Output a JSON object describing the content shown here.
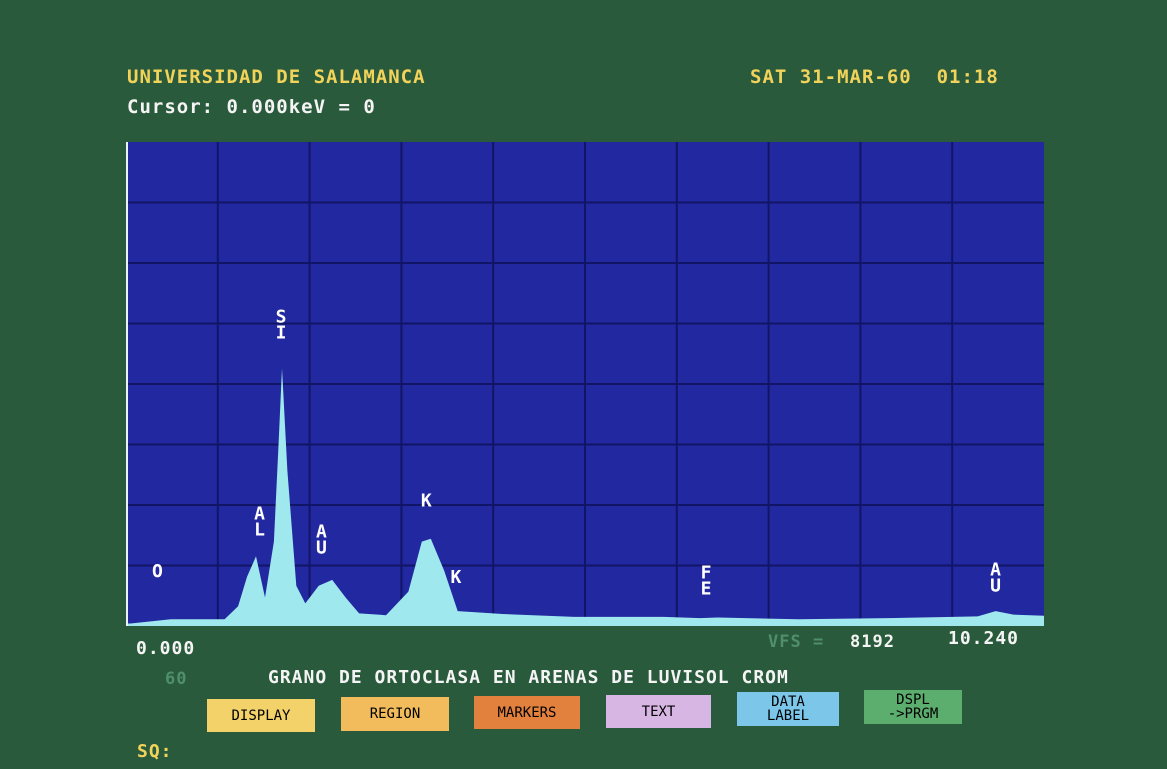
{
  "header": {
    "institution": "UNIVERSIDAD DE SALAMANCA",
    "datetime": "SAT 31-MAR-60  01:18",
    "cursor": "Cursor: 0.000keV = 0"
  },
  "axis": {
    "left_label": "0.000",
    "right_label": "10.240",
    "vfs_label": "VFS =",
    "vfs_value": "8192"
  },
  "aux_number": "60",
  "sample_title": "GRANO DE ORTOCLASA EN ARENAS DE LUVISOL CROM",
  "prompt": "SQ:",
  "menu": [
    {
      "label": "DISPLAY",
      "color": "#f3d26a"
    },
    {
      "label": "REGION",
      "color": "#f2bc5c"
    },
    {
      "label": "MARKERS",
      "color": "#e2803e"
    },
    {
      "label": "TEXT",
      "color": "#d7b6e4"
    },
    {
      "label1": "DATA",
      "label2": "LABEL",
      "color": "#7cc6ea"
    },
    {
      "label1": "DSPL",
      "label2": "->PRGM",
      "color": "#5cae6e"
    }
  ],
  "colors": {
    "plot_background": "#2228a0",
    "grid": "#111566",
    "spectrum": "#9fe8ee",
    "peak_label": "#ffffff"
  },
  "peak_labels": [
    "O",
    "AL",
    "SI",
    "AU",
    "K",
    "K",
    "FE",
    "AU"
  ],
  "chart_data": {
    "type": "area",
    "title": "",
    "xlabel": "",
    "ylabel": "",
    "xlim": [
      0.0,
      10.24
    ],
    "ylim": [
      0,
      8192
    ],
    "grid": true,
    "full_scale": 8192,
    "x": [
      0.0,
      0.5,
      1.1,
      1.25,
      1.35,
      1.45,
      1.55,
      1.65,
      1.7,
      1.74,
      1.8,
      1.9,
      2.0,
      2.15,
      2.3,
      2.45,
      2.6,
      2.9,
      3.15,
      3.3,
      3.4,
      3.55,
      3.7,
      3.9,
      4.2,
      5.0,
      6.0,
      6.4,
      6.6,
      7.5,
      8.5,
      9.5,
      9.7,
      9.9,
      10.24
    ],
    "y": [
      0,
      80,
      80,
      300,
      800,
      1150,
      450,
      1400,
      3000,
      4350,
      2600,
      650,
      350,
      650,
      750,
      450,
      180,
      150,
      550,
      1400,
      1450,
      900,
      220,
      200,
      170,
      120,
      120,
      100,
      110,
      80,
      100,
      130,
      220,
      160,
      140
    ],
    "labels": [
      {
        "text": "O",
        "x": 0.35,
        "y": 800
      },
      {
        "text": "AL",
        "x": 1.49,
        "y": 1500
      },
      {
        "text": "SI",
        "x": 1.73,
        "y": 4850
      },
      {
        "text": "AU",
        "x": 2.18,
        "y": 1200
      },
      {
        "text": "K",
        "x": 3.35,
        "y": 2000
      },
      {
        "text": "K",
        "x": 3.68,
        "y": 700
      },
      {
        "text": "FE",
        "x": 6.47,
        "y": 500
      },
      {
        "text": "AU",
        "x": 9.7,
        "y": 550
      }
    ]
  }
}
